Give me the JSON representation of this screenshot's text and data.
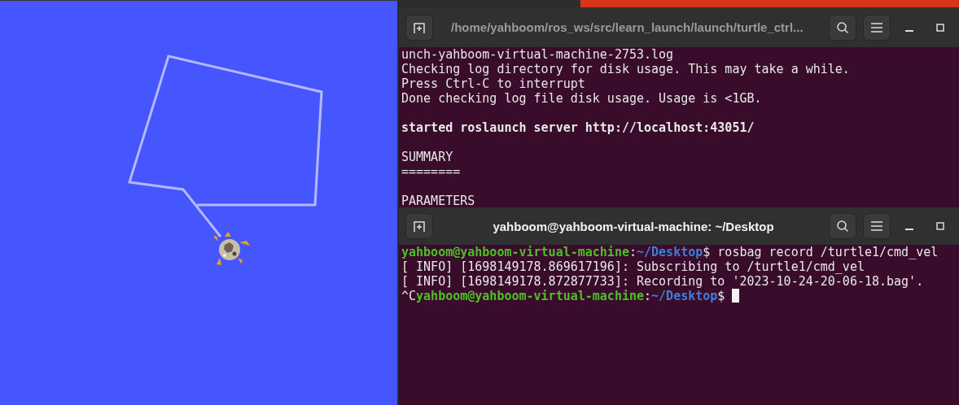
{
  "terminals": [
    {
      "title": "/home/yahboom/ros_ws/src/learn_launch/launch/turtle_ctrl...",
      "active": false,
      "blocks": [
        [
          {
            "segments": [
              {
                "kind": "plain",
                "text": "unch-yahboom-virtual-machine-2753.log"
              }
            ]
          },
          {
            "segments": [
              {
                "kind": "plain",
                "text": "Checking log directory for disk usage. This may take a while."
              }
            ]
          },
          {
            "segments": [
              {
                "kind": "plain",
                "text": "Press Ctrl-C to interrupt"
              }
            ]
          },
          {
            "segments": [
              {
                "kind": "plain",
                "text": "Done checking log file disk usage. Usage is <1GB."
              }
            ]
          }
        ],
        [
          {
            "segments": [
              {
                "kind": "bold",
                "text": "started roslaunch server http://localhost:43051/"
              }
            ]
          }
        ],
        [
          {
            "segments": [
              {
                "kind": "plain",
                "text": "SUMMARY"
              }
            ]
          },
          {
            "segments": [
              {
                "kind": "plain",
                "text": "========"
              }
            ]
          }
        ],
        [
          {
            "segments": [
              {
                "kind": "plain",
                "text": "PARAMETERS"
              }
            ]
          }
        ]
      ]
    },
    {
      "title": "yahboom@yahboom-virtual-machine: ~/Desktop",
      "active": true,
      "blocks": [
        [
          {
            "segments": [
              {
                "kind": "user",
                "text": "yahboom@yahboom-virtual-machine"
              },
              {
                "kind": "plain",
                "text": ":"
              },
              {
                "kind": "path",
                "text": "~/Desktop"
              },
              {
                "kind": "plain",
                "text": "$ rosbag record /turtle1/cmd_vel"
              }
            ]
          },
          {
            "segments": [
              {
                "kind": "plain",
                "text": "[ INFO] [1698149178.869617196]: Subscribing to /turtle1/cmd_vel"
              }
            ]
          },
          {
            "segments": [
              {
                "kind": "plain",
                "text": "[ INFO] [1698149178.872877733]: Recording to '2023-10-24-20-06-18.bag'."
              }
            ]
          },
          {
            "segments": [
              {
                "kind": "plain",
                "text": "^C"
              },
              {
                "kind": "user",
                "text": "yahboom@yahboom-virtual-machine"
              },
              {
                "kind": "plain",
                "text": ":"
              },
              {
                "kind": "path",
                "text": "~/Desktop"
              },
              {
                "kind": "plain",
                "text": "$ "
              }
            ],
            "cursor": true
          }
        ]
      ]
    }
  ]
}
